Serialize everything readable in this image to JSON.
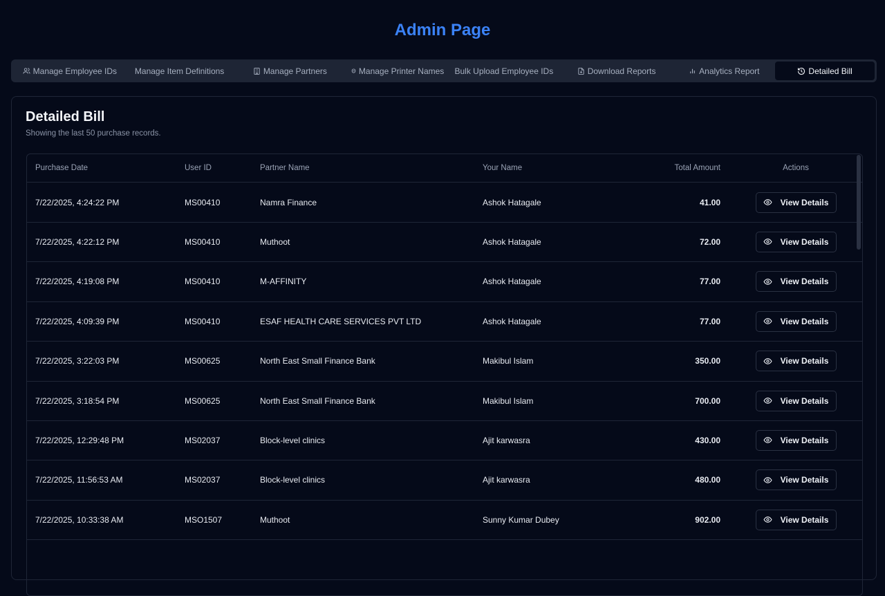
{
  "page_title": "Admin Page",
  "tabs": [
    {
      "label": "Manage Employee IDs",
      "icon": "users-icon",
      "active": false
    },
    {
      "label": "Manage Item Definitions",
      "icon": "",
      "active": false
    },
    {
      "label": "Manage Partners",
      "icon": "building-icon",
      "active": false
    },
    {
      "label": "Manage Printer Names",
      "icon": "printer-icon",
      "active": false
    },
    {
      "label": "Bulk Upload Employee IDs",
      "icon": "",
      "active": false
    },
    {
      "label": "Download Reports",
      "icon": "file-download-icon",
      "active": false
    },
    {
      "label": "Analytics Report",
      "icon": "bar-chart-icon",
      "active": false
    },
    {
      "label": "Detailed Bill",
      "icon": "history-icon",
      "active": true
    }
  ],
  "panel": {
    "title": "Detailed Bill",
    "subtitle": "Showing the last 50 purchase records."
  },
  "table": {
    "headers": {
      "date": "Purchase Date",
      "user": "User ID",
      "partner": "Partner Name",
      "name": "Your Name",
      "amount": "Total Amount",
      "actions": "Actions"
    },
    "action_label": "View Details",
    "rows": [
      {
        "date": "7/22/2025, 4:24:22 PM",
        "user": "MS00410",
        "partner": "Namra Finance",
        "name": "Ashok Hatagale",
        "amount": "41.00"
      },
      {
        "date": "7/22/2025, 4:22:12 PM",
        "user": "MS00410",
        "partner": "Muthoot",
        "name": "Ashok Hatagale",
        "amount": "72.00"
      },
      {
        "date": "7/22/2025, 4:19:08 PM",
        "user": "MS00410",
        "partner": "M-AFFINITY",
        "name": "Ashok Hatagale",
        "amount": "77.00"
      },
      {
        "date": "7/22/2025, 4:09:39 PM",
        "user": "MS00410",
        "partner": "ESAF HEALTH CARE SERVICES PVT LTD",
        "name": "Ashok Hatagale",
        "amount": "77.00"
      },
      {
        "date": "7/22/2025, 3:22:03 PM",
        "user": "MS00625",
        "partner": "North East Small Finance Bank",
        "name": "Makibul Islam",
        "amount": "350.00"
      },
      {
        "date": "7/22/2025, 3:18:54 PM",
        "user": "MS00625",
        "partner": "North East Small Finance Bank",
        "name": "Makibul Islam",
        "amount": "700.00"
      },
      {
        "date": "7/22/2025, 12:29:48 PM",
        "user": "MS02037",
        "partner": "Block-level clinics",
        "name": "Ajit karwasra",
        "amount": "430.00"
      },
      {
        "date": "7/22/2025, 11:56:53 AM",
        "user": "MS02037",
        "partner": "Block-level clinics",
        "name": "Ajit karwasra",
        "amount": "480.00"
      },
      {
        "date": "7/22/2025, 10:33:38 AM",
        "user": "MSO1507",
        "partner": "Muthoot",
        "name": "Sunny Kumar Dubey",
        "amount": "902.00"
      }
    ]
  },
  "colors": {
    "background": "#050a19",
    "accent": "#3b82f6",
    "tab_bar": "#1e2535",
    "border": "#1f2637"
  }
}
